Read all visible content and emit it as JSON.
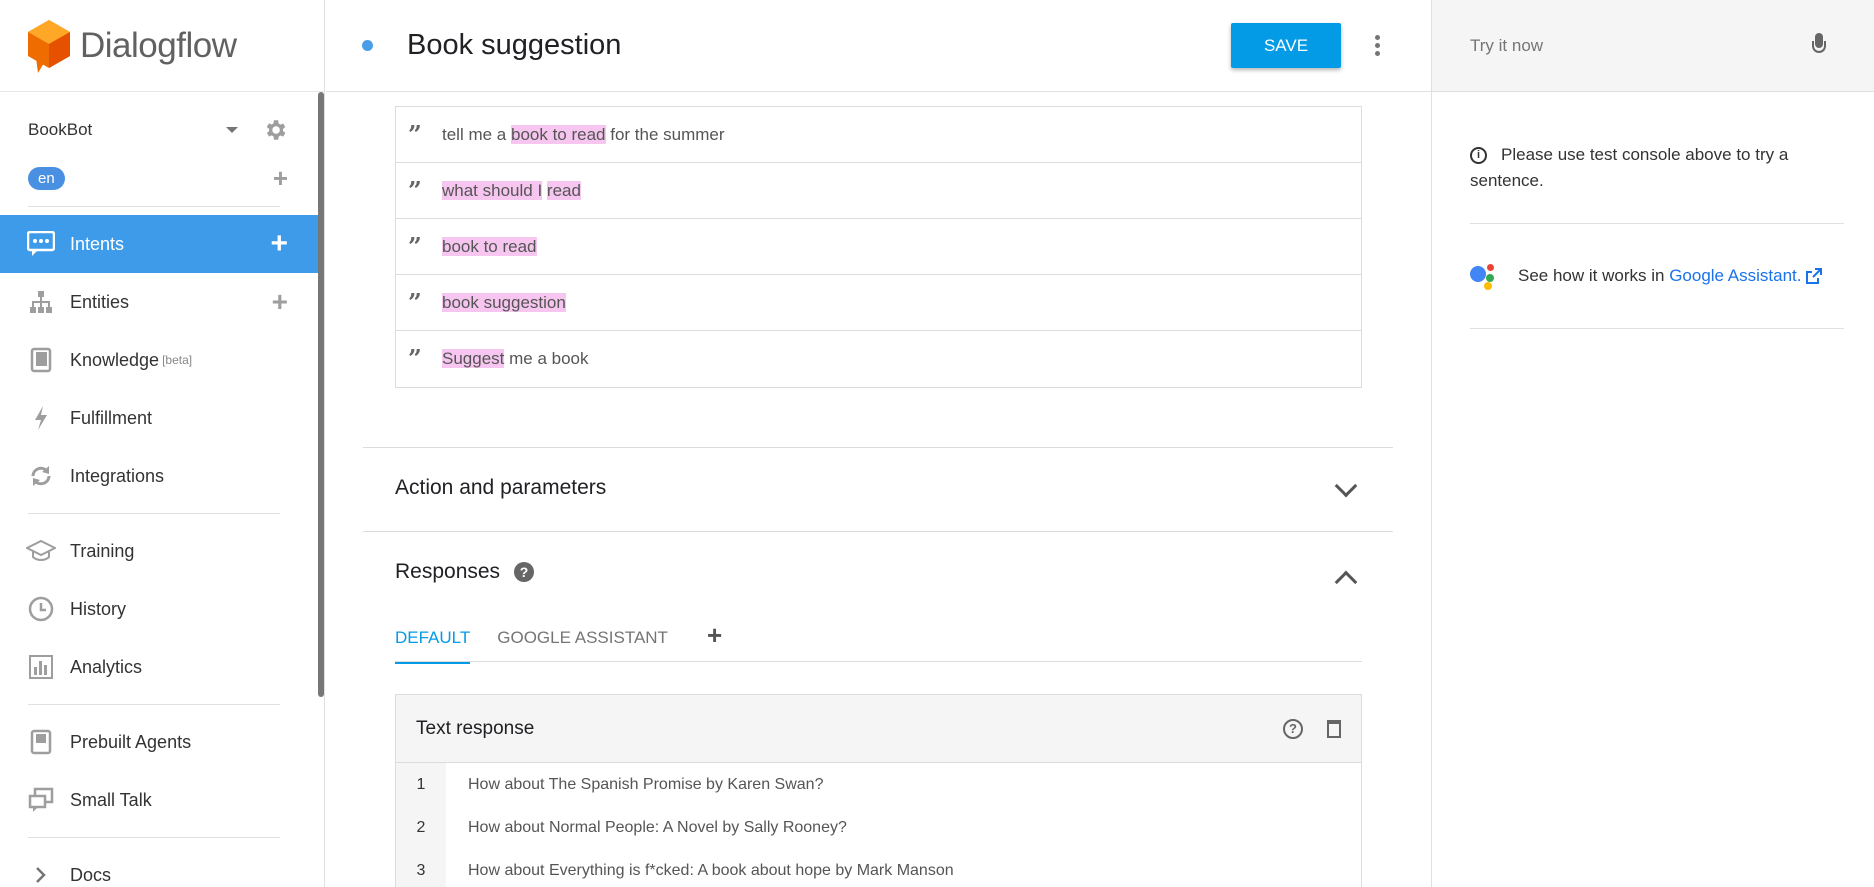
{
  "brand": {
    "name": "Dialogflow"
  },
  "agent": {
    "name": "BookBot",
    "language": "en"
  },
  "sidebar": {
    "items": [
      {
        "label": "Intents"
      },
      {
        "label": "Entities"
      },
      {
        "label": "Knowledge",
        "badge": "[beta]"
      },
      {
        "label": "Fulfillment"
      },
      {
        "label": "Integrations"
      },
      {
        "label": "Training"
      },
      {
        "label": "History"
      },
      {
        "label": "Analytics"
      },
      {
        "label": "Prebuilt Agents"
      },
      {
        "label": "Small Talk"
      },
      {
        "label": "Docs"
      }
    ]
  },
  "header": {
    "intent_name": "Book suggestion",
    "save_label": "SAVE"
  },
  "training_phrases": [
    {
      "parts": [
        {
          "t": "tell me a ",
          "h": false
        },
        {
          "t": "book to read",
          "h": true
        },
        {
          "t": " for the summer",
          "h": false
        }
      ]
    },
    {
      "parts": [
        {
          "t": "what should I",
          "h": true
        },
        {
          "t": " ",
          "h": false
        },
        {
          "t": "read",
          "h": true
        }
      ]
    },
    {
      "parts": [
        {
          "t": "book to read",
          "h": true
        }
      ]
    },
    {
      "parts": [
        {
          "t": "book suggestion",
          "h": true
        }
      ]
    },
    {
      "parts": [
        {
          "t": "Suggest",
          "h": true
        },
        {
          "t": " me a book",
          "h": false
        }
      ]
    }
  ],
  "sections": {
    "action_params": "Action and parameters",
    "responses": "Responses"
  },
  "response_tabs": {
    "default": "DEFAULT",
    "google": "GOOGLE ASSISTANT"
  },
  "text_response": {
    "title": "Text response",
    "rows": [
      {
        "num": "1",
        "text": "How about The Spanish Promise by Karen Swan?"
      },
      {
        "num": "2",
        "text": "How about Normal People: A Novel by Sally Rooney?"
      },
      {
        "num": "3",
        "text": "How about Everything is f*cked: A book about hope by Mark Manson"
      }
    ]
  },
  "right_panel": {
    "try_placeholder": "Try it now",
    "info_text": "Please use test console above to try a sentence.",
    "ga_text": "See how it works in ",
    "ga_link": "Google Assistant."
  },
  "colors": {
    "accent": "#039be5",
    "active_nav": "#3d9be9",
    "highlight": "#f7c6f0",
    "logo_orange": "#f57c00"
  }
}
